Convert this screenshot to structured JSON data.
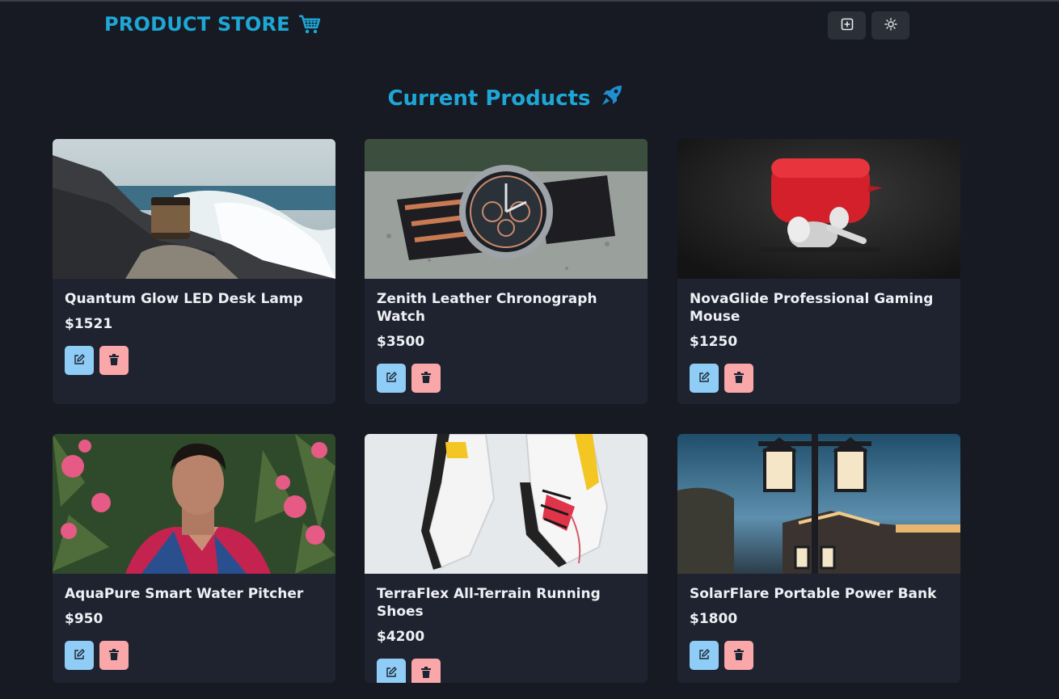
{
  "brand": {
    "title": "PRODUCT STORE",
    "icon": "cart-icon",
    "color": "#1ea7d6"
  },
  "nav": {
    "add_button_icon": "plus-square-icon",
    "theme_button_icon": "sun-icon"
  },
  "heading": {
    "text": "Current Products",
    "icon": "rocket-icon"
  },
  "colors": {
    "background": "#171a23",
    "card": "#1f2330",
    "edit_button": "#8fcdf6",
    "delete_button": "#f9a7a9"
  },
  "products": [
    {
      "name": "Quantum Glow LED Desk Lamp",
      "price": "$1521",
      "image": "jar-on-rocks-by-waves"
    },
    {
      "name": "Zenith Leather Chronograph Watch",
      "price": "$3500",
      "image": "chronograph-watch-on-gravel"
    },
    {
      "name": "NovaGlide Professional Gaming Mouse",
      "price": "$1250",
      "image": "red-earbuds-case"
    },
    {
      "name": "AquaPure Smart Water Pitcher",
      "price": "$950",
      "image": "man-among-pink-flowers"
    },
    {
      "name": "TerraFlex All-Terrain Running Shoes",
      "price": "$4200",
      "image": "white-running-shoes"
    },
    {
      "name": "SolarFlare Portable Power Bank",
      "price": "$1800",
      "image": "street-lamp-at-dusk"
    }
  ]
}
